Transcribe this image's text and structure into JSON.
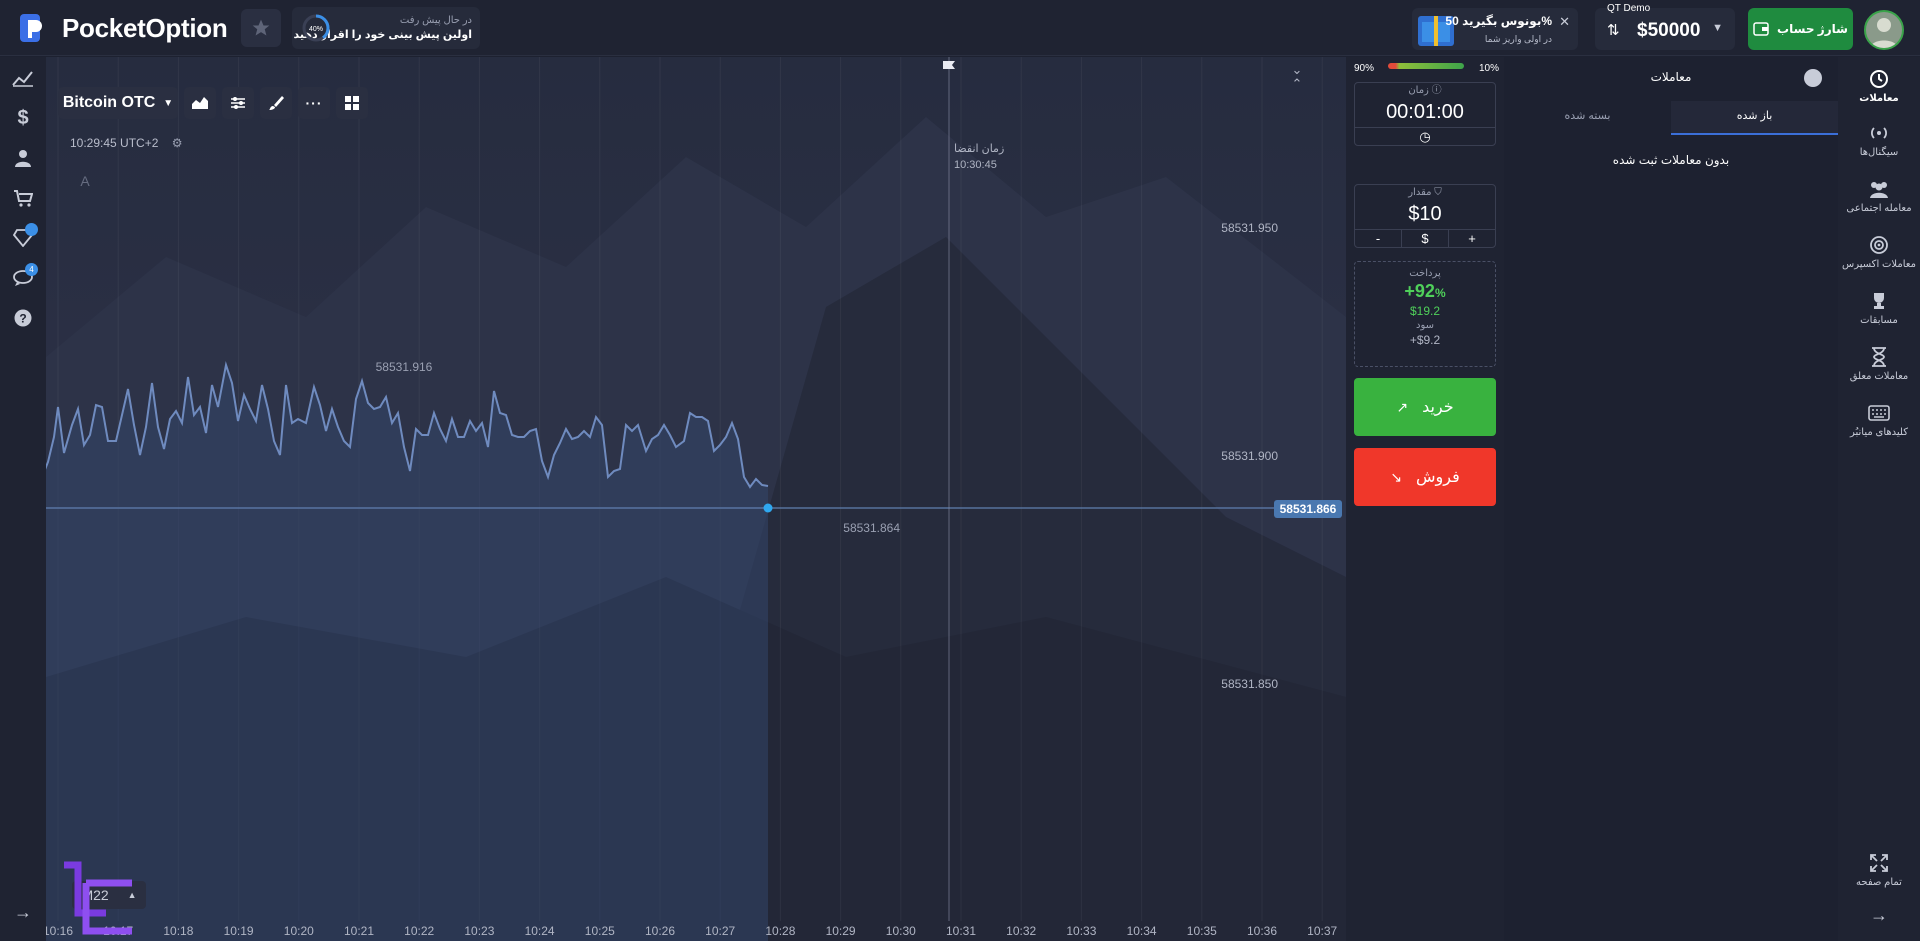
{
  "header": {
    "logo_text": "PocketOption",
    "promo": {
      "percent": "40%",
      "line1": "در حال پیش رفت",
      "line2": "اولین پیش بینی خود را اقرار دهید"
    },
    "bonus": {
      "title": "بونوس بگیرید 50%",
      "subtitle": "در اولی واریز شما",
      "close": "✕"
    },
    "account": {
      "label": "QT Demo",
      "balance": "$50000"
    },
    "topup_label": "شارژ حساب"
  },
  "left_nav": [
    "chart-icon",
    "dollar-icon",
    "user-icon",
    "cart-icon",
    "diamond-icon",
    "chat-icon",
    "help-icon"
  ],
  "left_badges": {
    "diamond": "",
    "chat": "4"
  },
  "chart": {
    "asset": "Bitcoin OTC",
    "clock": "10:29:45 UTC+2",
    "drawing_label": "A",
    "expiry_label": "زمان انقضا",
    "expiry_time": "10:30:45",
    "timeframe": "M22",
    "price_labels": [
      "58531.950",
      "58531.900",
      "58531.850"
    ],
    "current_price": "58531.866",
    "high_label": "58531.916",
    "entry_label": "58531.864",
    "x_ticks": [
      "10:16",
      "10:17",
      "10:18",
      "10:19",
      "10:20",
      "10:21",
      "10:22",
      "10:23",
      "10:24",
      "10:25",
      "10:26",
      "10:27",
      "10:28",
      "10:29",
      "10:30",
      "10:31",
      "10:32",
      "10:33",
      "10:34",
      "10:35",
      "10:36",
      "10:37"
    ],
    "colors": {
      "line": "#6f8bbf",
      "area": "#33466a",
      "marker": "#2fa8f0"
    }
  },
  "trade_panel": {
    "sentiment_left": "90%",
    "sentiment_right": "10%",
    "time_caption": "زمان",
    "time_value": "00:01:00",
    "amount_caption": "مقدار",
    "amount_value": "$10",
    "amount_buttons": [
      "-",
      "$",
      "+"
    ],
    "payout_caption": "پرداخت",
    "payout_pct": "+92",
    "payout_pct_sign": "%",
    "payout_amount": "$19.2",
    "profit_caption": "سود",
    "profit_value": "+$9.2",
    "buy_label": "خرید",
    "sell_label": "فروش"
  },
  "trades_panel": {
    "title": "معاملات",
    "tab_open": "باز شده",
    "tab_closed": "بسته شده",
    "empty_text": "بدون معاملات ثبت شده"
  },
  "right_nav": [
    {
      "label": "معاملات",
      "icon": "history-icon"
    },
    {
      "label": "سیگنال‌ها",
      "icon": "signal-icon"
    },
    {
      "label": "معامله اجتماعی",
      "icon": "users-icon"
    },
    {
      "label": "معاملات اکسپرس",
      "icon": "target-icon"
    },
    {
      "label": "مسابقات",
      "icon": "trophy-icon"
    },
    {
      "label": "معاملات معلق",
      "icon": "hourglass-icon"
    },
    {
      "label": "کلیدهای میانبُر",
      "icon": "keyboard-icon"
    }
  ],
  "fullscreen_label": "تمام صفحه"
}
